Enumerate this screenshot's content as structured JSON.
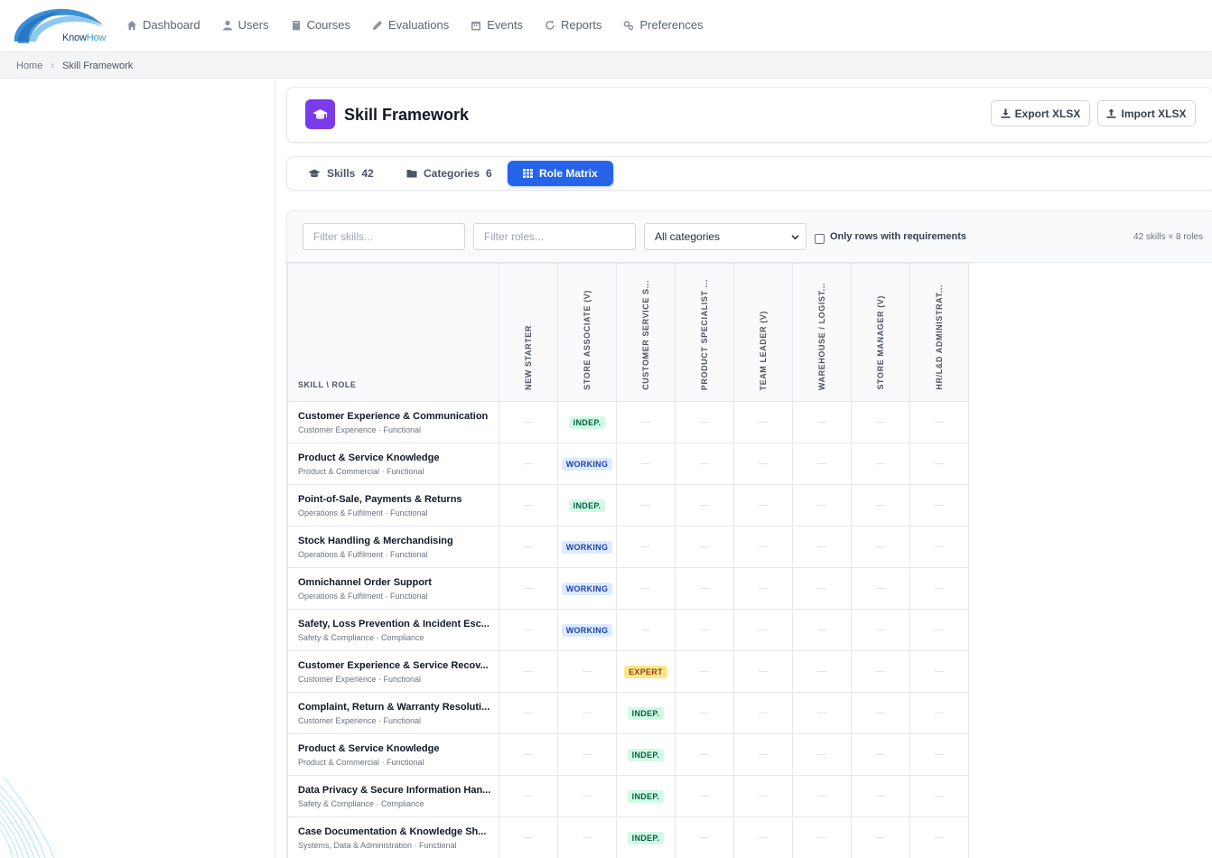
{
  "app": {
    "logo_text_know": "Know",
    "logo_text_how": "How"
  },
  "nav": {
    "items": [
      {
        "label": "Dashboard",
        "icon": "home-icon"
      },
      {
        "label": "Users",
        "icon": "user-icon"
      },
      {
        "label": "Courses",
        "icon": "book-icon"
      },
      {
        "label": "Evaluations",
        "icon": "pencil-icon"
      },
      {
        "label": "Events",
        "icon": "calendar-icon"
      },
      {
        "label": "Reports",
        "icon": "refresh-icon"
      },
      {
        "label": "Preferences",
        "icon": "cogs-icon"
      }
    ]
  },
  "breadcrumb": {
    "home": "Home",
    "separator": "›",
    "current": "Skill Framework"
  },
  "header": {
    "title": "Skill Framework",
    "export_label": "Export XLSX",
    "import_label": "Import XLSX"
  },
  "tabs": [
    {
      "label": "Skills",
      "count": "42",
      "icon": "graduation-cap-icon",
      "active": false
    },
    {
      "label": "Categories",
      "count": "6",
      "icon": "folder-icon",
      "active": false
    },
    {
      "label": "Role Matrix",
      "count": "",
      "icon": "grid-icon",
      "active": true
    }
  ],
  "filters": {
    "skills_placeholder": "Filter skills...",
    "roles_placeholder": "Filter roles...",
    "category_selected": "All categories",
    "only_rows_label": "Only rows with requirements",
    "count_label": "42 skills × 8 roles"
  },
  "matrix": {
    "corner_label": "SKILL \\ ROLE",
    "empty_marker": "—",
    "roles": [
      "NEW STARTER",
      "STORE ASSOCIATE (V)",
      "CUSTOMER SERVICE S...",
      "PRODUCT SPECIALIST ...",
      "TEAM LEADER (V)",
      "WAREHOUSE / LOGIST...",
      "STORE MANAGER (V)",
      "HR/L&D ADMINISTRAT..."
    ],
    "rows": [
      {
        "name": "Customer Experience & Communication",
        "meta": "Customer Experience · Functional",
        "cells": [
          "",
          "INDEP.",
          "",
          "",
          "",
          "",
          "",
          ""
        ]
      },
      {
        "name": "Product & Service Knowledge",
        "meta": "Product & Commercial · Functional",
        "cells": [
          "",
          "WORKING",
          "",
          "",
          "",
          "",
          "",
          ""
        ]
      },
      {
        "name": "Point-of-Sale, Payments & Returns",
        "meta": "Operations & Fulfilment · Functional",
        "cells": [
          "",
          "INDEP.",
          "",
          "",
          "",
          "",
          "",
          ""
        ]
      },
      {
        "name": "Stock Handling & Merchandising",
        "meta": "Operations & Fulfilment · Functional",
        "cells": [
          "",
          "WORKING",
          "",
          "",
          "",
          "",
          "",
          ""
        ]
      },
      {
        "name": "Omnichannel Order Support",
        "meta": "Operations & Fulfilment · Functional",
        "cells": [
          "",
          "WORKING",
          "",
          "",
          "",
          "",
          "",
          ""
        ]
      },
      {
        "name": "Safety, Loss Prevention & Incident Esc...",
        "meta": "Safety & Compliance · Compliance",
        "cells": [
          "",
          "WORKING",
          "",
          "",
          "",
          "",
          "",
          ""
        ]
      },
      {
        "name": "Customer Experience & Service Recov...",
        "meta": "Customer Experience · Functional",
        "cells": [
          "",
          "",
          "EXPERT",
          "",
          "",
          "",
          "",
          ""
        ]
      },
      {
        "name": "Complaint, Return & Warranty Resoluti...",
        "meta": "Customer Experience · Functional",
        "cells": [
          "",
          "",
          "INDEP.",
          "",
          "",
          "",
          "",
          ""
        ]
      },
      {
        "name": "Product & Service Knowledge",
        "meta": "Product & Commercial · Functional",
        "cells": [
          "",
          "",
          "INDEP.",
          "",
          "",
          "",
          "",
          ""
        ]
      },
      {
        "name": "Data Privacy & Secure Information Han...",
        "meta": "Safety & Compliance · Compliance",
        "cells": [
          "",
          "",
          "INDEP.",
          "",
          "",
          "",
          "",
          ""
        ]
      },
      {
        "name": "Case Documentation & Knowledge Sh...",
        "meta": "Systems, Data & Administration · Functional",
        "cells": [
          "",
          "",
          "INDEP.",
          "",
          "",
          "",
          "",
          ""
        ]
      }
    ]
  },
  "colors": {
    "primary": "#2563eb",
    "header_icon_bg": "#7c3aed",
    "indep_bg": "#d1fae5",
    "working_bg": "#dbeafe",
    "expert_bg": "#fde68a"
  }
}
